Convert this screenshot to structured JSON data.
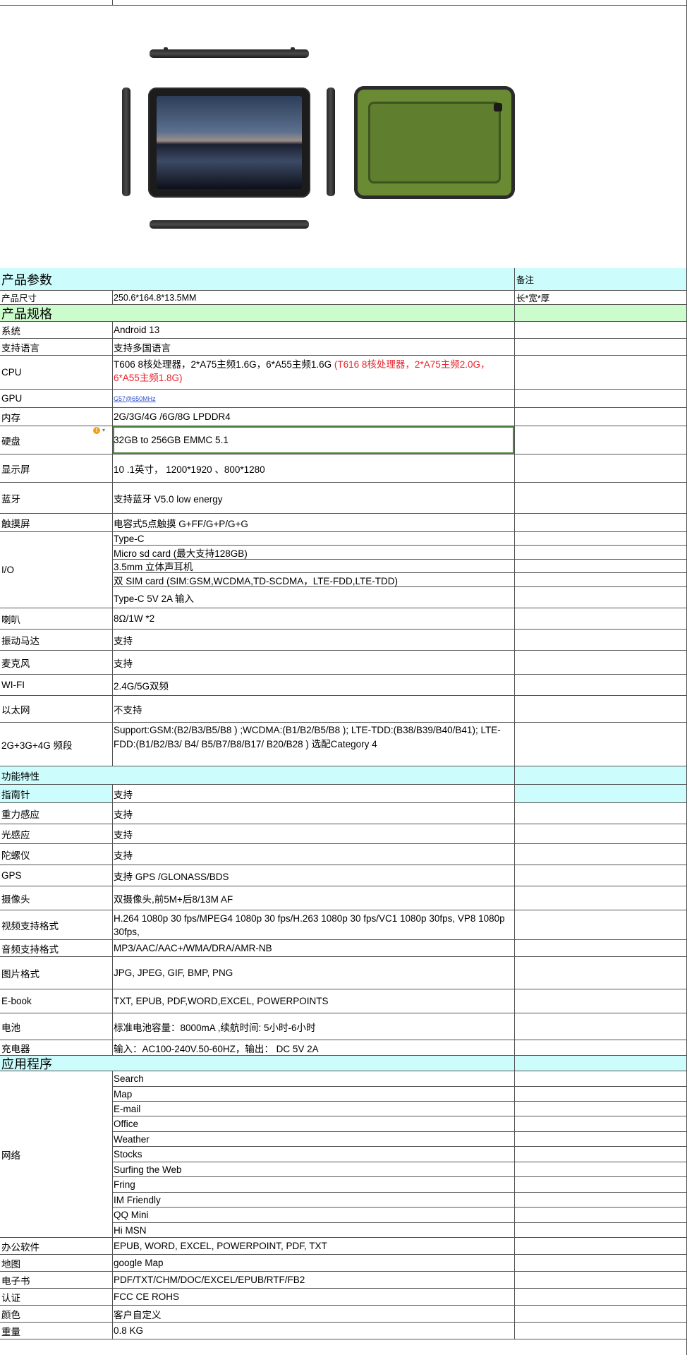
{
  "sections": {
    "params": {
      "title": "产品参数",
      "note_header": "备注",
      "size_label": "产品尺寸",
      "size_value": "250.6*164.8*13.5MM",
      "size_note": "长*宽*厚"
    },
    "specs": {
      "title": "产品规格"
    },
    "features": {
      "title": "功能特性"
    },
    "apps": {
      "title": "应用程序"
    }
  },
  "specs": {
    "system": {
      "label": "系统",
      "value": " Android 13"
    },
    "language": {
      "label": "支持语言",
      "value": "支持多国语言"
    },
    "cpu": {
      "label": "CPU",
      "value": "T606 8核处理器，2*A75主频1.6G，6*A55主频1.6G",
      "value_alt": "(T616 8核处理器，2*A75主频2.0G，6*A55主频1.8G)"
    },
    "gpu": {
      "label": "GPU",
      "value": "G57@650MHz"
    },
    "memory": {
      "label": "内存",
      "value": "2G/3G/4G /6G/8G  LPDDR4"
    },
    "storage": {
      "label": "硬盘",
      "value": "32GB to 256GB   EMMC 5.1"
    },
    "display": {
      "label": "显示屏",
      "value": "10 .1英寸，  1200*1920 、800*1280"
    },
    "bluetooth": {
      "label": "蓝牙",
      "value": "支持蓝牙   V5.0 low energy"
    },
    "touch": {
      "label": "触摸屏",
      "value": "电容式5点触摸 G+FF/G+P/G+G"
    },
    "io": {
      "label": " I/O",
      "items": [
        "Type-C",
        "Micro sd card (最大支持128GB)",
        "3.5mm 立体声耳机",
        "双 SIM card (SIM:GSM,WCDMA,TD-SCDMA，LTE-FDD,LTE-TDD)",
        "Type-C 5V 2A 输入"
      ]
    },
    "speaker": {
      "label": "喇叭",
      "value": "8Ω/1W *2"
    },
    "vibration": {
      "label": "振动马达",
      "value": "支持"
    },
    "mic": {
      "label": "麦克风",
      "value": "支持"
    },
    "wifi": {
      "label": "WI-FI",
      "value": "2.4G/5G双频"
    },
    "ethernet": {
      "label": "以太网",
      "value": "不支持"
    },
    "bands": {
      "label": "2G+3G+4G 频段",
      "value": "Support:GSM:(B2/B3/B5/B8 ) ;WCDMA:(B1/B2/B5/B8 ); LTE-TDD:(B38/B39/B40/B41);   LTE-FDD:(B1/B2/B3/ B4/ B5/B7/B8/B17/ B20/B28 ) 选配Category 4"
    }
  },
  "features": {
    "compass": {
      "label": "指南针",
      "value": "支持"
    },
    "gravity": {
      "label": "重力感应",
      "value": "支持"
    },
    "light": {
      "label": "光感应",
      "value": "支持"
    },
    "gyro": {
      "label": "陀螺仪",
      "value": "支持"
    },
    "gps": {
      "label": "GPS",
      "value": "支持 GPS /GLONASS/BDS"
    },
    "camera": {
      "label": "摄像头",
      "value": "双摄像头,前5M+后8/13M AF"
    },
    "video": {
      "label": "视频支持格式",
      "value": " H.264  1080p 30 fps/MPEG4 1080p 30 fps/H.263 1080p 30 fps/VC1 1080p 30fps, VP8 1080p 30fps,"
    },
    "audio": {
      "label": "音频支持格式",
      "value": "MP3/AAC/AAC+/WMA/DRA/AMR-NB"
    },
    "image": {
      "label": "图片格式",
      "value": "JPG, JPEG, GIF, BMP, PNG"
    },
    "ebook": {
      "label": "E-book",
      "value": "TXT, EPUB, PDF,WORD,EXCEL, POWERPOINTS"
    },
    "battery": {
      "label": "电池",
      "value": "标准电池容量：8000mA ,续航时间: 5小时-6小时"
    },
    "charger": {
      "label": "充电器",
      "value": "输入：AC100-240V.50-60HZ，输出：  DC 5V  2A"
    }
  },
  "apps": {
    "network": {
      "label": "网络",
      "items": [
        "Search",
        "Map",
        "E-mail",
        "Office",
        "Weather",
        "Stocks",
        "Surfing the Web",
        "Fring",
        "IM  Friendly",
        "QQ Mini",
        "Hi MSN"
      ]
    },
    "office": {
      "label": "办公软件",
      "value": "EPUB, WORD, EXCEL, POWERPOINT, PDF, TXT"
    },
    "map": {
      "label": "地图",
      "value": "google Map"
    },
    "ebook": {
      "label": "电子书",
      "value": "PDF/TXT/CHM/DOC/EXCEL/EPUB/RTF/FB2"
    },
    "cert": {
      "label": "认证",
      "value": "FCC  CE  ROHS"
    },
    "color": {
      "label": "颜色",
      "value": "客户自定义"
    },
    "weight": {
      "label": "重量",
      "value": "0.8 KG"
    }
  },
  "colors": {
    "header_cyan": "#ccfcfc",
    "header_green": "#ccfccc",
    "alt_red": "#e8242c",
    "device_green": "#6b8a34"
  }
}
